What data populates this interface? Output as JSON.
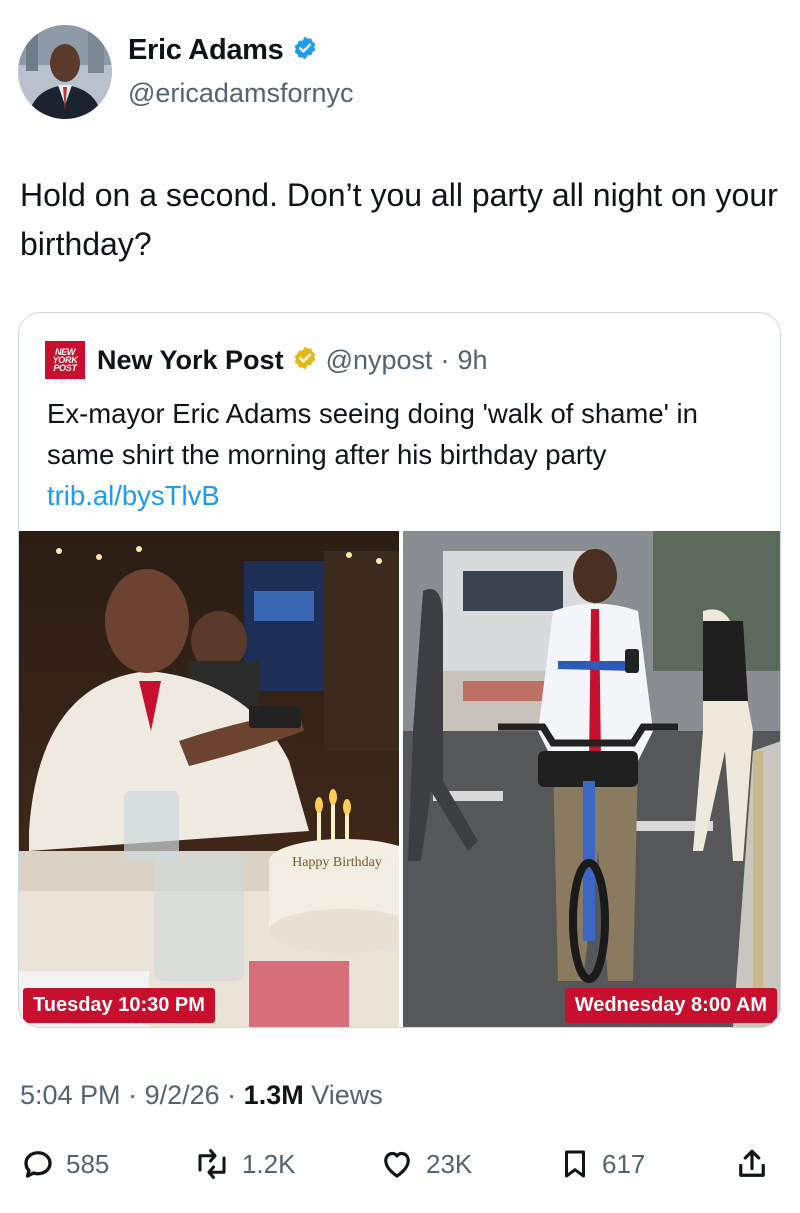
{
  "author": {
    "name": "Eric Adams",
    "handle": "@ericadamsfornyc",
    "verified_color": "#1d9bf0"
  },
  "tweet": {
    "text": "Hold on a second. Don’t you all party all night on your birthday?"
  },
  "quote": {
    "logo_lines": [
      "NEW",
      "YORK",
      "POST"
    ],
    "name": "New York Post",
    "verified_color": "#e2b719",
    "handle": "@nypost",
    "time": "9h",
    "text": "Ex-mayor Eric Adams seeing doing 'walk of shame' in same shirt the morning after his birthday party ",
    "link": "trib.al/bysTlvB",
    "images": {
      "left_caption": "Tuesday 10:30 PM",
      "right_caption": "Wednesday 8:00 AM"
    },
    "cake_text": "Happy Birthday"
  },
  "meta": {
    "time": "5:04 PM",
    "date": "9/2/26",
    "views_count": "1.3M",
    "views_label": "Views"
  },
  "actions": {
    "replies": "585",
    "reposts": "1.2K",
    "likes": "23K",
    "bookmarks": "617"
  },
  "colors": {
    "accent": "#1d9bf0",
    "nyp_red": "#c8102e",
    "muted": "#536471"
  }
}
